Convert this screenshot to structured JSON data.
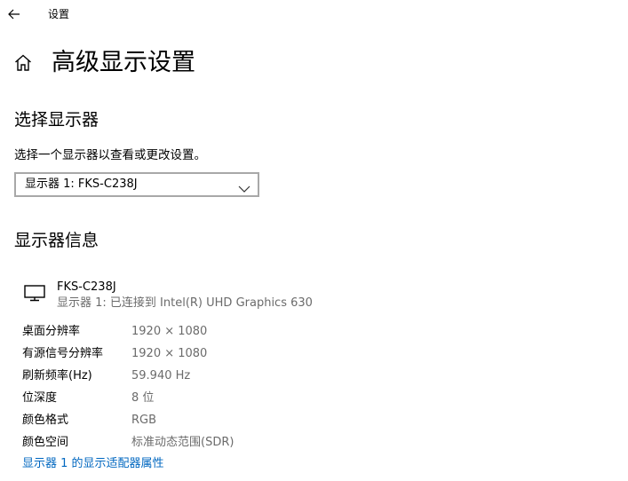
{
  "window": {
    "title": "设置",
    "back_icon": "back-arrow-icon"
  },
  "page": {
    "home_icon": "home-icon",
    "title": "高级显示设置"
  },
  "select_display": {
    "heading": "选择显示器",
    "hint": "选择一个显示器以查看或更改设置。",
    "dropdown": {
      "selected": "显示器 1: FKS-C238J",
      "chevron_icon": "chevron-down-icon"
    }
  },
  "display_info": {
    "heading": "显示器信息",
    "monitor": {
      "icon": "monitor-icon",
      "name": "FKS-C238J",
      "connection": "显示器 1: 已连接到 Intel(R) UHD Graphics 630"
    },
    "rows": [
      {
        "label": "桌面分辨率",
        "value": "1920 × 1080"
      },
      {
        "label": "有源信号分辨率",
        "value": "1920 × 1080"
      },
      {
        "label": "刷新频率(Hz)",
        "value": "59.940 Hz"
      },
      {
        "label": "位深度",
        "value": "8 位"
      },
      {
        "label": "颜色格式",
        "value": "RGB"
      },
      {
        "label": "颜色空间",
        "value": "标准动态范围(SDR)"
      }
    ],
    "adapter_link": "显示器 1 的显示适配器属性"
  },
  "colors": {
    "link": "#0067c0",
    "secondary_text": "#6b6b6b",
    "border": "#a8a8a8"
  }
}
